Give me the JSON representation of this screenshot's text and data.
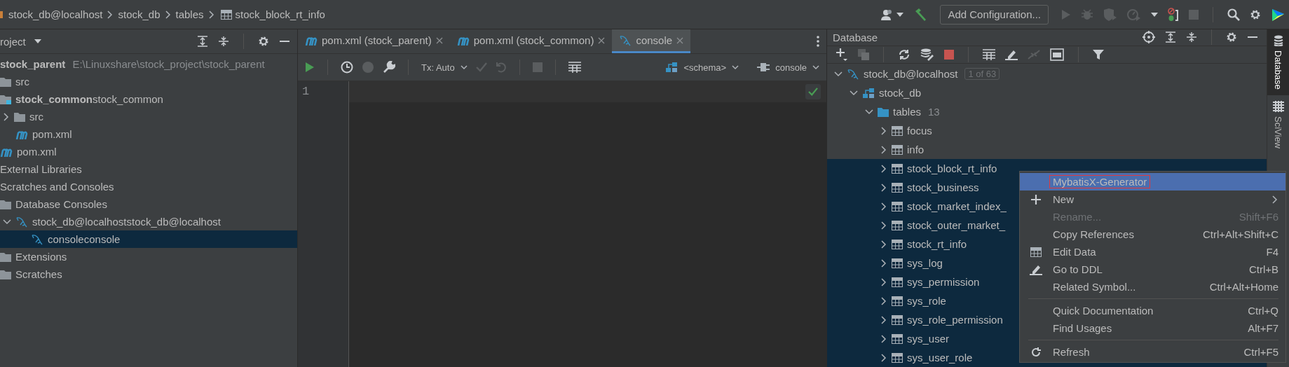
{
  "breadcrumb": [
    {
      "label": "stock_db@localhost",
      "kind": "plain"
    },
    {
      "label": "stock_db",
      "kind": "plain"
    },
    {
      "label": "tables",
      "kind": "plain"
    },
    {
      "label": "stock_block_rt_info",
      "kind": "table"
    }
  ],
  "run_configuration": "Add Configuration...",
  "project": {
    "title": "roject",
    "tree": [
      {
        "label": "**stock_parent**",
        "hint": "E:\\Linuxshare\\stock_project\\stock_parent",
        "selected": false,
        "children": [
          {
            "label": "src",
            "kind": "folder",
            "selected": false
          },
          {
            "label": "**stock_common**stock_common",
            "kind": "module",
            "selected": false,
            "children": [
              {
                "label": "src",
                "kind": "folder",
                "expanded": false,
                "selected": false
              },
              {
                "label": "pom.xml",
                "kind": "maven",
                "selected": false
              }
            ]
          },
          {
            "label": "pom.xml",
            "kind": "maven",
            "selected": false
          }
        ]
      },
      {
        "label": "External Libraries",
        "selected": false
      },
      {
        "label": "Scratches and Consoles",
        "selected": false,
        "children": [
          {
            "label": "Database Consoles",
            "kind": "folder",
            "selected": false,
            "children": [
              {
                "label": "stock_db@localhoststock_db@localhost",
                "kind": "mysql",
                "expanded": true,
                "selected": false,
                "children": [
                  {
                    "label": "consoleconsole",
                    "kind": "mysql",
                    "selected": true
                  }
                ]
              }
            ]
          },
          {
            "label": "Extensions",
            "kind": "folder",
            "selected": false
          },
          {
            "label": "Scratches",
            "kind": "folder",
            "selected": false
          }
        ]
      }
    ]
  },
  "editor": {
    "tabs": [
      {
        "label": "pom.xml (stock_parent)",
        "kind": "maven",
        "selected": false
      },
      {
        "label": "pom.xml (stock_common)",
        "kind": "maven",
        "selected": false
      },
      {
        "label": "console",
        "kind": "mysql",
        "selected": true
      }
    ],
    "transaction": "Tx: Auto",
    "schema": "<schema>",
    "session": "console",
    "line_numbers": [
      "1"
    ]
  },
  "database": {
    "title": "Database",
    "tree": [
      {
        "label": "stock_db@localhost",
        "badge": "1 of 63",
        "kind": "mysql",
        "expanded": true,
        "selected": false,
        "children": [
          {
            "label": "stock_db",
            "kind": "schema",
            "expanded": true,
            "selected": false,
            "children": [
              {
                "label": "tables",
                "count": "13",
                "kind": "dbfolder",
                "expanded": true,
                "selected": false,
                "children": [
                  {
                    "label": "focus",
                    "kind": "table",
                    "expanded": false,
                    "selected": false
                  },
                  {
                    "label": "info",
                    "kind": "table",
                    "expanded": false,
                    "selected": false
                  },
                  {
                    "label": "stock_block_rt_info",
                    "kind": "table",
                    "expanded": false,
                    "selected": true
                  },
                  {
                    "label": "stock_business",
                    "kind": "table",
                    "expanded": false,
                    "selected": true
                  },
                  {
                    "label": "stock_market_index_",
                    "kind": "table",
                    "expanded": false,
                    "selected": true
                  },
                  {
                    "label": "stock_outer_market_",
                    "kind": "table",
                    "expanded": false,
                    "selected": true
                  },
                  {
                    "label": "stock_rt_info",
                    "kind": "table",
                    "expanded": false,
                    "selected": true
                  },
                  {
                    "label": "sys_log",
                    "kind": "table",
                    "expanded": false,
                    "selected": true
                  },
                  {
                    "label": "sys_permission",
                    "kind": "table",
                    "expanded": false,
                    "selected": true
                  },
                  {
                    "label": "sys_role",
                    "kind": "table",
                    "expanded": false,
                    "selected": true
                  },
                  {
                    "label": "sys_role_permission",
                    "kind": "table",
                    "expanded": false,
                    "selected": true
                  },
                  {
                    "label": "sys_user",
                    "kind": "table",
                    "expanded": false,
                    "selected": true
                  },
                  {
                    "label": "sys_user_role",
                    "kind": "table",
                    "expanded": false,
                    "selected": true
                  }
                ]
              }
            ]
          }
        ]
      }
    ]
  },
  "side_stripe": [
    {
      "label": "Database",
      "kind": "database",
      "selected": true
    },
    {
      "label": "SciView",
      "kind": "grid",
      "selected": false
    }
  ],
  "context_menu": [
    {
      "kind": "item",
      "label": "MybatisX-Generator",
      "selected": true,
      "outlined": true,
      "disabled": false
    },
    {
      "kind": "submenu",
      "label": "New",
      "selected": false,
      "outlined": false,
      "disabled": false
    },
    {
      "kind": "item",
      "label": "Rename...",
      "shortcut": "Shift+F6",
      "selected": false,
      "outlined": false,
      "disabled": true
    },
    {
      "kind": "item",
      "label": "Copy References",
      "shortcut": "Ctrl+Alt+Shift+C",
      "selected": false,
      "outlined": false,
      "disabled": false
    },
    {
      "kind": "table",
      "label": "Edit Data",
      "shortcut": "F4",
      "selected": false,
      "outlined": false,
      "disabled": false
    },
    {
      "kind": "pencil",
      "label": "Go to DDL",
      "shortcut": "Ctrl+B",
      "selected": false,
      "outlined": false,
      "disabled": false
    },
    {
      "kind": "item",
      "label": "Related Symbol...",
      "shortcut": "Ctrl+Alt+Home",
      "selected": false,
      "outlined": false,
      "disabled": false
    },
    {
      "kind": "separator"
    },
    {
      "kind": "item",
      "label": "Quick Documentation",
      "shortcut": "Ctrl+Q",
      "selected": false,
      "outlined": false,
      "disabled": false
    },
    {
      "kind": "item",
      "label": "Find Usages",
      "shortcut": "Alt+F7",
      "selected": false,
      "outlined": false,
      "disabled": false
    },
    {
      "kind": "separator"
    },
    {
      "kind": "refresh",
      "label": "Refresh",
      "shortcut": "Ctrl+F5",
      "selected": false,
      "outlined": false,
      "disabled": false
    }
  ]
}
